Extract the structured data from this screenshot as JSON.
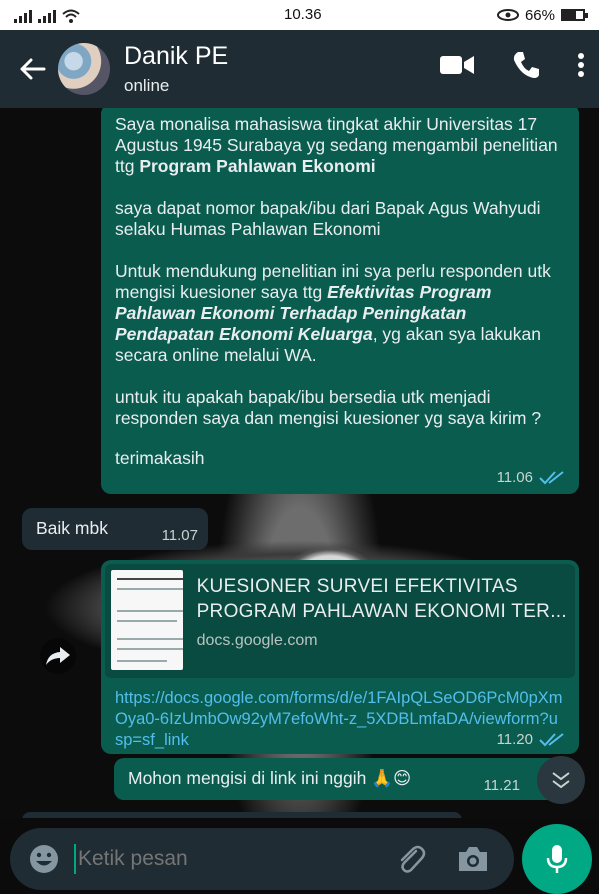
{
  "status_bar": {
    "time": "10.36",
    "battery": "66%",
    "battery_level": 0.66
  },
  "header": {
    "contact_name": "Danik PE",
    "contact_status": "online",
    "icons": [
      "back-arrow-icon",
      "video-call-icon",
      "voice-call-icon",
      "more-options-icon"
    ]
  },
  "messages": {
    "m1": {
      "line1": "Saya monalisa mahasiswa tingkat akhir Universitas 17 Agustus 1945 Surabaya yg sedang mengambil penelitian ttg ",
      "line1_bold": "Program Pahlawan Ekonomi",
      "para2": "saya dapat nomor bapak/ibu dari Bapak Agus Wahyudi selaku Humas Pahlawan Ekonomi",
      "para3_start": "Untuk mendukung penelitian ini sya perlu responden utk mengisi kuesioner saya ttg ",
      "para3_bold_italic": "Efektivitas Program Pahlawan Ekonomi Terhadap Peningkatan Pendapatan Ekonomi Keluarga",
      "para3_end": ", yg akan sya lakukan secara online melalui WA.",
      "para4": "untuk itu apakah bapak/ibu bersedia utk menjadi responden saya dan mengisi kuesioner yg saya kirim ?",
      "para5": "terimakasih",
      "time": "11.06"
    },
    "m2": {
      "text": "Baik mbk",
      "time": "11.07"
    },
    "m3": {
      "preview_title": "KUESIONER SURVEI EFEKTIVITAS PROGRAM PAHLAWAN EKONOMI TER...",
      "preview_domain": "docs.google.com",
      "link": "https://docs.google.com/forms/d/e/1FAIpQLSeOD6PcM0pXmOya0-6IzUmbOw92yM7efoWht-z_5XDBLmfaDA/viewform?usp=sf_link",
      "time": "11.20"
    },
    "m4": {
      "text": "Mohon mengisi di link ini nggih 🙏😊",
      "time": "11.21"
    }
  },
  "footer": {
    "input_placeholder": "Ketik pesan",
    "icons": [
      "emoji-icon",
      "attach-icon",
      "camera-icon",
      "mic-icon"
    ]
  },
  "colors": {
    "header_bg": "#1f2c33",
    "outgoing_bubble": "#0a5c4f",
    "incoming_bubble": "#1f2c33",
    "link": "#53bdeb",
    "accent": "#00a884"
  }
}
